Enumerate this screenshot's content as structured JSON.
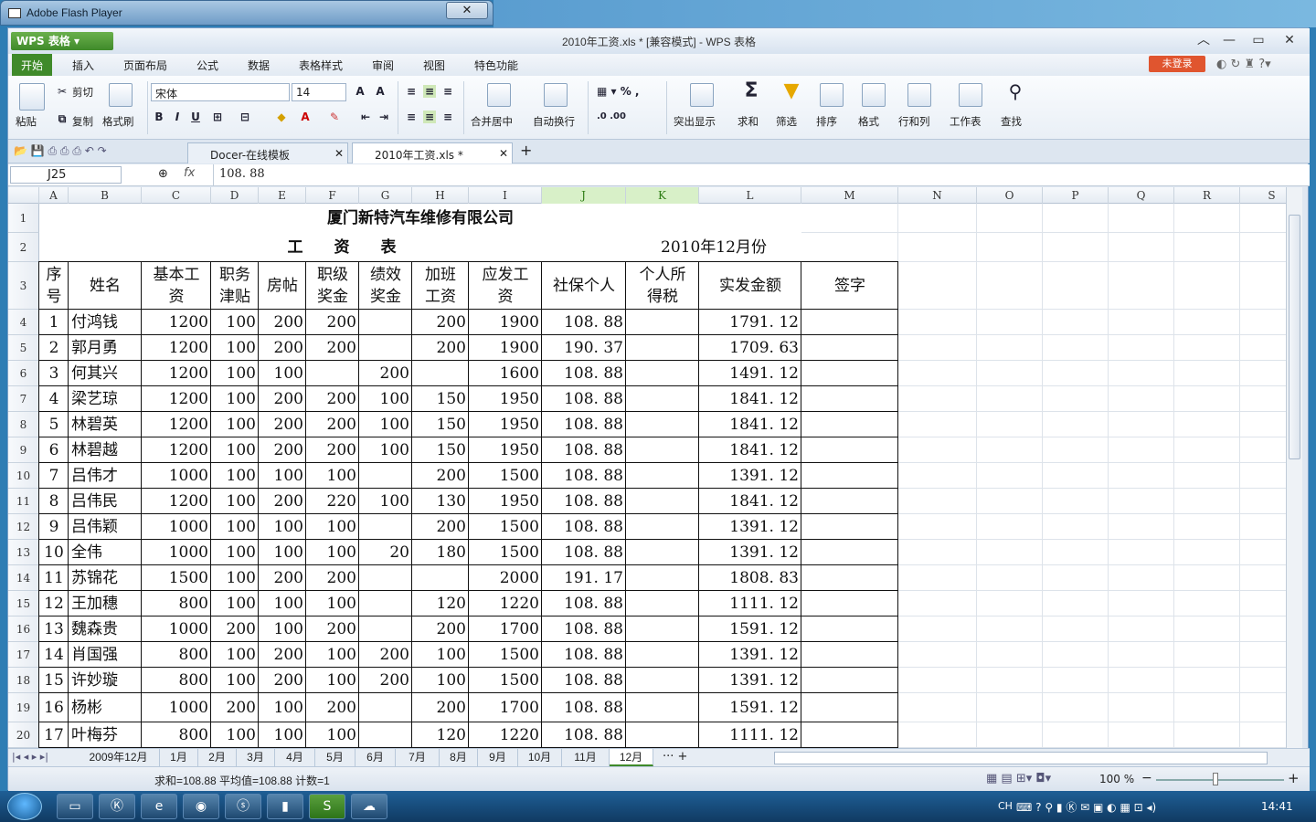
{
  "flash": {
    "title": "Adobe Flash Player",
    "close": "✕"
  },
  "app": {
    "wps_label": "WPS 表格",
    "title": "2010年工资.xls * [兼容模式] - WPS 表格",
    "login": "未登录"
  },
  "menu": [
    "开始",
    "插入",
    "页面布局",
    "公式",
    "数据",
    "表格样式",
    "审阅",
    "视图",
    "特色功能"
  ],
  "ribbon": {
    "paste": "粘贴",
    "cut": "剪切",
    "copy": "复制",
    "format_painter": "格式刷",
    "font": "宋体",
    "size": "14",
    "merge": "合并居中",
    "wrap": "自动换行",
    "highlight": "突出显示",
    "sum": "求和",
    "filter": "筛选",
    "sort": "排序",
    "format": "格式",
    "rowcol": "行和列",
    "sheet": "工作表",
    "find": "查找"
  },
  "tabs": {
    "docer": "Docer-在线模板",
    "file": "2010年工资.xls *",
    "add": "+"
  },
  "formula": {
    "namebox": "J25",
    "fx": "fx",
    "value": "108. 88"
  },
  "columns": [
    "A",
    "B",
    "C",
    "D",
    "E",
    "F",
    "G",
    "H",
    "I",
    "J",
    "K",
    "L",
    "M",
    "N",
    "O",
    "P",
    "Q",
    "R",
    "S"
  ],
  "sheet": {
    "company": "厦门新特汽车维修有限公司",
    "title": "工　　资　　表",
    "month": "2010年12月份",
    "headers": [
      [
        "序",
        "号"
      ],
      [
        "姓名"
      ],
      [
        "基本工",
        "资"
      ],
      [
        "职务",
        "津贴"
      ],
      [
        "房帖"
      ],
      [
        "职级",
        "奖金"
      ],
      [
        "绩效",
        "奖金"
      ],
      [
        "加班",
        "工资"
      ],
      [
        "应发工",
        "资"
      ],
      [
        "社保个人"
      ],
      [
        "个人所",
        "得税"
      ],
      [
        "实发金额"
      ],
      [
        "签字"
      ]
    ],
    "rows": [
      [
        "1",
        "付鸿钱",
        "1200",
        "100",
        "200",
        "200",
        "",
        "200",
        "1900",
        "108. 88",
        "",
        "1791. 12"
      ],
      [
        "2",
        "郭月勇",
        "1200",
        "100",
        "200",
        "200",
        "",
        "200",
        "1900",
        "190. 37",
        "",
        "1709. 63"
      ],
      [
        "3",
        "何其兴",
        "1200",
        "100",
        "100",
        "",
        "200",
        "",
        "1600",
        "108. 88",
        "",
        "1491. 12"
      ],
      [
        "4",
        "梁艺琼",
        "1200",
        "100",
        "200",
        "200",
        "100",
        "150",
        "1950",
        "108. 88",
        "",
        "1841. 12"
      ],
      [
        "5",
        "林碧英",
        "1200",
        "100",
        "200",
        "200",
        "100",
        "150",
        "1950",
        "108. 88",
        "",
        "1841. 12"
      ],
      [
        "6",
        "林碧越",
        "1200",
        "100",
        "200",
        "200",
        "100",
        "150",
        "1950",
        "108. 88",
        "",
        "1841. 12"
      ],
      [
        "7",
        "吕伟才",
        "1000",
        "100",
        "100",
        "100",
        "",
        "200",
        "1500",
        "108. 88",
        "",
        "1391. 12"
      ],
      [
        "8",
        "吕伟民",
        "1200",
        "100",
        "200",
        "220",
        "100",
        "130",
        "1950",
        "108. 88",
        "",
        "1841. 12"
      ],
      [
        "9",
        "吕伟颖",
        "1000",
        "100",
        "100",
        "100",
        "",
        "200",
        "1500",
        "108. 88",
        "",
        "1391. 12"
      ],
      [
        "10",
        "全伟",
        "1000",
        "100",
        "100",
        "100",
        "20",
        "180",
        "1500",
        "108. 88",
        "",
        "1391. 12"
      ],
      [
        "11",
        "苏锦花",
        "1500",
        "100",
        "200",
        "200",
        "",
        "",
        "2000",
        "191. 17",
        "",
        "1808. 83"
      ],
      [
        "12",
        "王加穗",
        "800",
        "100",
        "100",
        "100",
        "",
        "120",
        "1220",
        "108. 88",
        "",
        "1111. 12"
      ],
      [
        "13",
        "魏森贵",
        "1000",
        "200",
        "100",
        "200",
        "",
        "200",
        "1700",
        "108. 88",
        "",
        "1591. 12"
      ],
      [
        "14",
        "肖国强",
        "800",
        "100",
        "200",
        "100",
        "200",
        "100",
        "1500",
        "108. 88",
        "",
        "1391. 12"
      ],
      [
        "15",
        "许妙璇",
        "800",
        "100",
        "200",
        "100",
        "200",
        "100",
        "1500",
        "108. 88",
        "",
        "1391. 12"
      ],
      [
        "16",
        "杨彬",
        "1000",
        "200",
        "100",
        "200",
        "",
        "200",
        "1700",
        "108. 88",
        "",
        "1591. 12"
      ],
      [
        "17",
        "叶梅芬",
        "800",
        "100",
        "100",
        "100",
        "",
        "120",
        "1220",
        "108. 88",
        "",
        "1111. 12"
      ]
    ]
  },
  "sheet_tabs": [
    "2009年12月",
    "1月",
    "2月",
    "3月",
    "4月",
    "5月",
    "6月",
    "7月",
    "8月",
    "9月",
    "10月",
    "11月",
    "12月"
  ],
  "status": {
    "text": "求和=108.88  平均值=108.88  计数=1",
    "zoom": "100 %"
  },
  "taskbar": {
    "lang": "CH",
    "time": "14:41"
  }
}
